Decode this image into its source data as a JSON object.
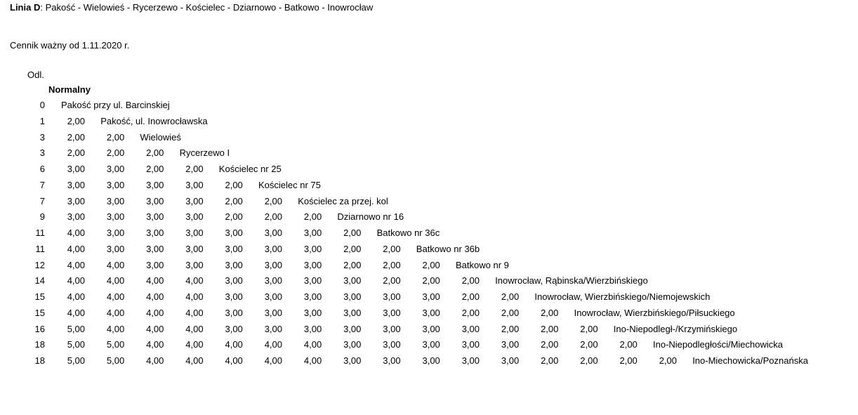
{
  "header": {
    "line_label": "Linia D",
    "route": ": Pakość - Wielowieś - Rycerzewo - Kościelec - Dziarnowo - Batkowo - Inowrocław",
    "valid_from": "Cennik ważny od 1.11.2020 r."
  },
  "table": {
    "distance_header": "Odl.",
    "fare_header": "Normalny",
    "rows": [
      {
        "distance": "0",
        "prices": [],
        "stop": "Pakość przy ul. Barcinskiej"
      },
      {
        "distance": "1",
        "prices": [
          "2,00"
        ],
        "stop": "Pakość, ul. Inowrocławska"
      },
      {
        "distance": "3",
        "prices": [
          "2,00",
          "2,00"
        ],
        "stop": "Wielowieś"
      },
      {
        "distance": "3",
        "prices": [
          "2,00",
          "2,00",
          "2,00"
        ],
        "stop": "Rycerzewo I"
      },
      {
        "distance": "6",
        "prices": [
          "3,00",
          "3,00",
          "2,00",
          "2,00"
        ],
        "stop": "Kościelec nr 25"
      },
      {
        "distance": "7",
        "prices": [
          "3,00",
          "3,00",
          "3,00",
          "3,00",
          "2,00"
        ],
        "stop": "Kościelec nr 75"
      },
      {
        "distance": "7",
        "prices": [
          "3,00",
          "3,00",
          "3,00",
          "3,00",
          "2,00",
          "2,00"
        ],
        "stop": "Kościelec za przej. kol"
      },
      {
        "distance": "9",
        "prices": [
          "3,00",
          "3,00",
          "3,00",
          "3,00",
          "2,00",
          "2,00",
          "2,00"
        ],
        "stop": "Dziarnowo nr 16"
      },
      {
        "distance": "11",
        "prices": [
          "4,00",
          "3,00",
          "3,00",
          "3,00",
          "3,00",
          "3,00",
          "3,00",
          "2,00"
        ],
        "stop": "Batkowo nr 36c"
      },
      {
        "distance": "11",
        "prices": [
          "4,00",
          "3,00",
          "3,00",
          "3,00",
          "3,00",
          "3,00",
          "3,00",
          "2,00",
          "2,00"
        ],
        "stop": "Batkowo nr 36b"
      },
      {
        "distance": "12",
        "prices": [
          "4,00",
          "4,00",
          "3,00",
          "3,00",
          "3,00",
          "3,00",
          "3,00",
          "2,00",
          "2,00",
          "2,00"
        ],
        "stop": "Batkowo nr 9"
      },
      {
        "distance": "14",
        "prices": [
          "4,00",
          "4,00",
          "4,00",
          "4,00",
          "3,00",
          "3,00",
          "3,00",
          "3,00",
          "2,00",
          "2,00",
          "2,00"
        ],
        "stop": "Inowrocław, Rąbinska/Wierzbińskiego"
      },
      {
        "distance": "15",
        "prices": [
          "4,00",
          "4,00",
          "4,00",
          "4,00",
          "3,00",
          "3,00",
          "3,00",
          "3,00",
          "3,00",
          "3,00",
          "2,00",
          "2,00"
        ],
        "stop": "Inowrocław, Wierzbińskiego/Niemojewskich"
      },
      {
        "distance": "15",
        "prices": [
          "4,00",
          "4,00",
          "4,00",
          "4,00",
          "3,00",
          "3,00",
          "3,00",
          "3,00",
          "3,00",
          "3,00",
          "2,00",
          "2,00",
          "2,00"
        ],
        "stop": "Inowrocław, Wierzbińskiego/Piłsuckiego"
      },
      {
        "distance": "16",
        "prices": [
          "5,00",
          "4,00",
          "4,00",
          "4,00",
          "3,00",
          "3,00",
          "3,00",
          "3,00",
          "3,00",
          "3,00",
          "3,00",
          "2,00",
          "2,00",
          "2,00"
        ],
        "stop": "Ino-Niepodległ-/Krzymińskiego"
      },
      {
        "distance": "18",
        "prices": [
          "5,00",
          "5,00",
          "4,00",
          "4,00",
          "4,00",
          "4,00",
          "4,00",
          "3,00",
          "3,00",
          "3,00",
          "3,00",
          "3,00",
          "2,00",
          "2,00",
          "2,00"
        ],
        "stop": "Ino-Niepodległości/Miechowicka"
      },
      {
        "distance": "18",
        "prices": [
          "5,00",
          "5,00",
          "4,00",
          "4,00",
          "4,00",
          "4,00",
          "4,00",
          "3,00",
          "3,00",
          "3,00",
          "3,00",
          "3,00",
          "2,00",
          "2,00",
          "2,00",
          "2,00"
        ],
        "stop": "Ino-Miechowicka/Poznańska"
      }
    ]
  }
}
